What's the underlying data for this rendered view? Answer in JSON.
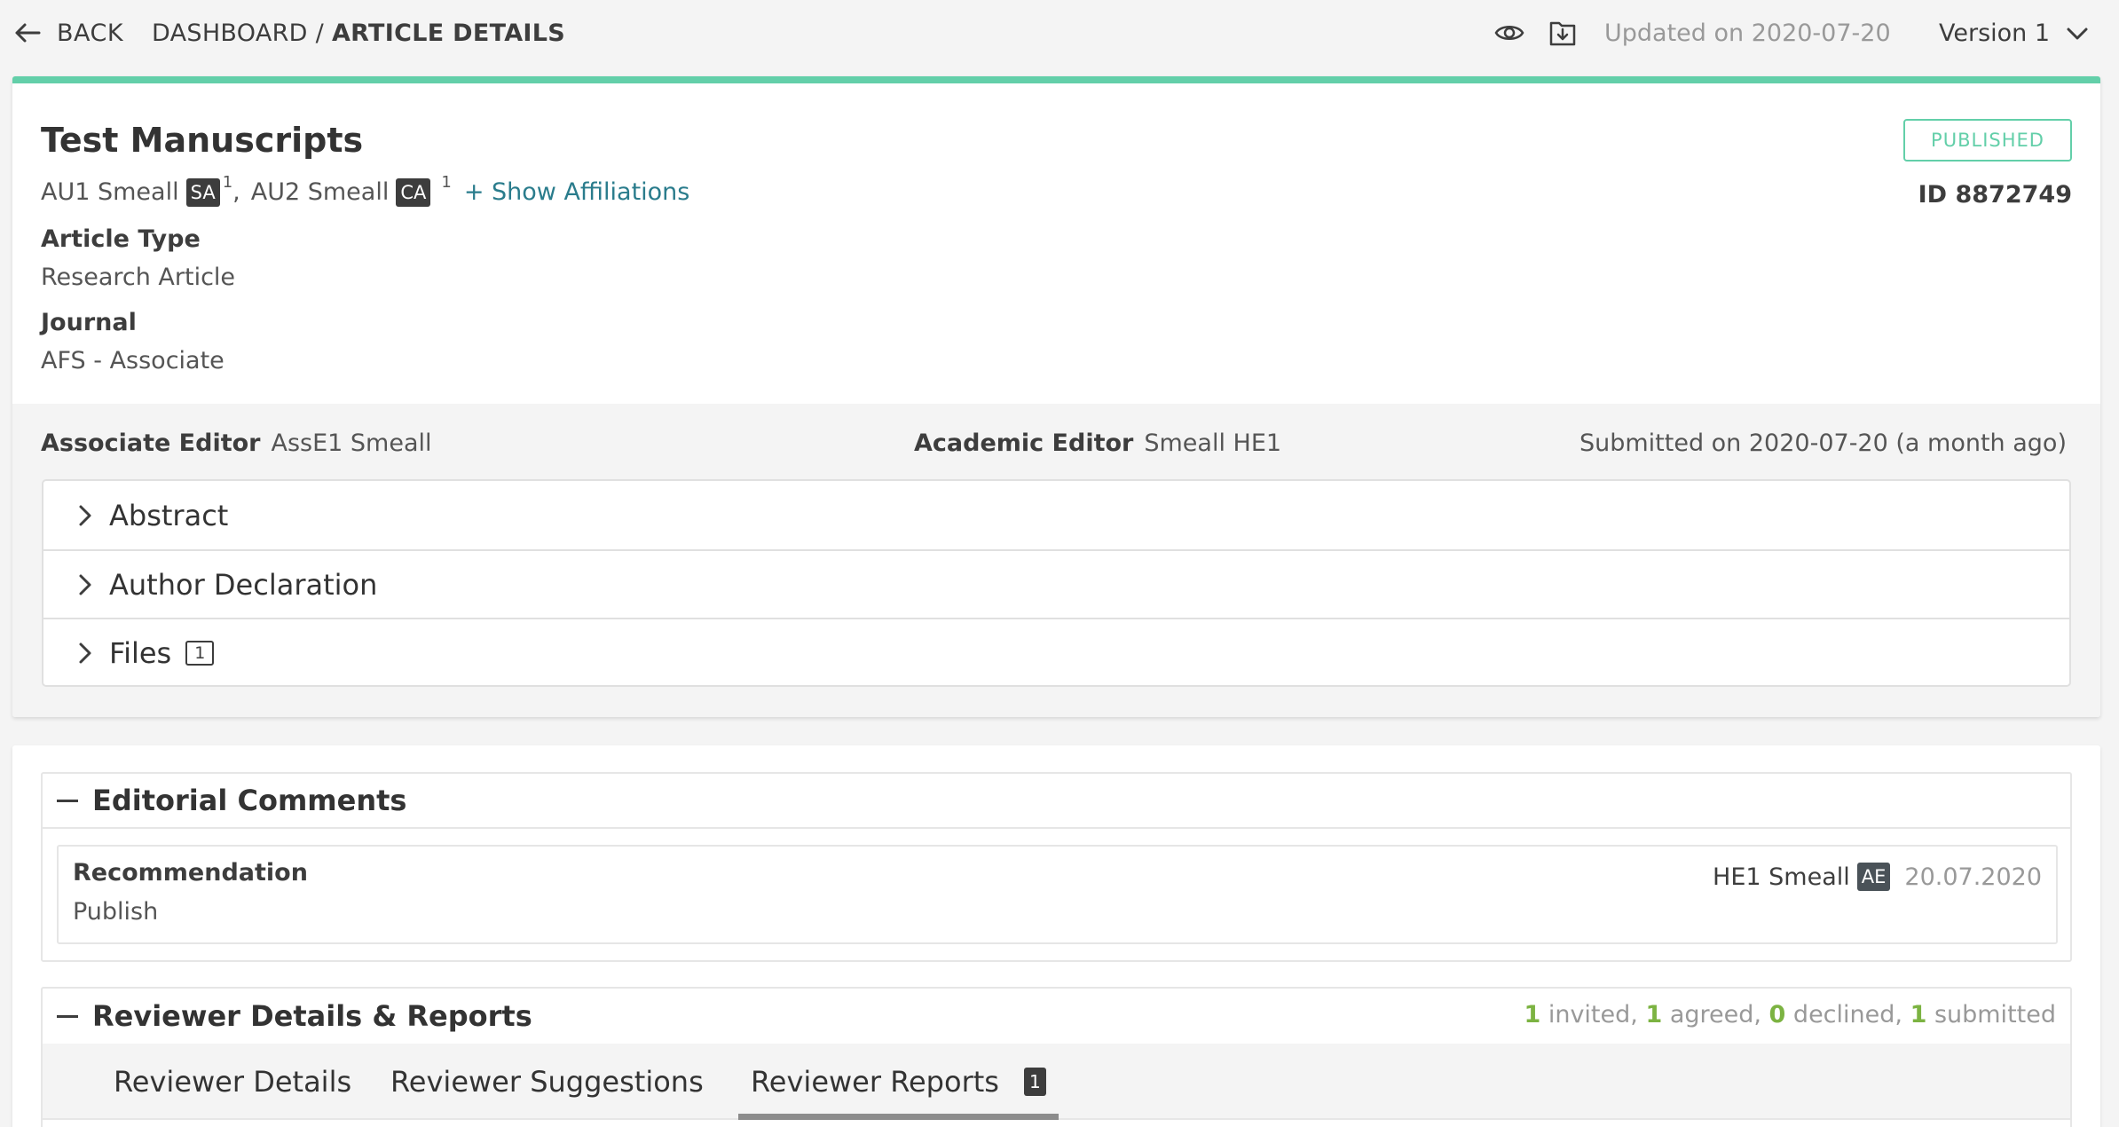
{
  "topbar": {
    "back_label": "BACK",
    "breadcrumb_root": "DASHBOARD / ",
    "breadcrumb_current": "ARTICLE DETAILS",
    "updated": "Updated on 2020-07-20",
    "version": "Version 1"
  },
  "article": {
    "title": "Test Manuscripts",
    "status": "PUBLISHED",
    "id": "ID 8872749",
    "authors": [
      {
        "name": "AU1 Smeall",
        "badge": "SA",
        "sup": "1"
      },
      {
        "name": "AU2 Smeall",
        "badge": "CA",
        "sup": "1"
      }
    ],
    "author_separator": ",",
    "show_affiliations": "+ Show Affiliations",
    "article_type_label": "Article Type",
    "article_type": "Research Article",
    "journal_label": "Journal",
    "journal": "AFS - Associate",
    "associate_editor_label": "Associate Editor",
    "associate_editor": "AssE1 Smeall",
    "academic_editor_label": "Academic Editor",
    "academic_editor": "Smeall HE1",
    "submitted": "Submitted on 2020-07-20 (a month ago)",
    "sections": [
      {
        "label": "Abstract"
      },
      {
        "label": "Author Declaration"
      },
      {
        "label": "Files",
        "count": "1"
      }
    ]
  },
  "editorial": {
    "title": "Editorial Comments",
    "recommendation_label": "Recommendation",
    "recommendation": "Publish",
    "editor_name": "HE1 Smeall",
    "editor_badge": "AE",
    "date": "20.07.2020"
  },
  "reviewers": {
    "title": "Reviewer Details & Reports",
    "stats": {
      "invited": "1",
      "invited_label": " invited, ",
      "agreed": "1",
      "agreed_label": " agreed, ",
      "declined": "0",
      "declined_label": " declined, ",
      "submitted": "1",
      "submitted_label": " submitted"
    },
    "tabs": [
      {
        "label": "Reviewer Details"
      },
      {
        "label": "Reviewer Suggestions"
      },
      {
        "label": "Reviewer Reports",
        "count": "1"
      }
    ]
  },
  "colors": {
    "accent": "#63cfa9",
    "link": "#2a7c8c",
    "stat_green": "#7cb342"
  }
}
